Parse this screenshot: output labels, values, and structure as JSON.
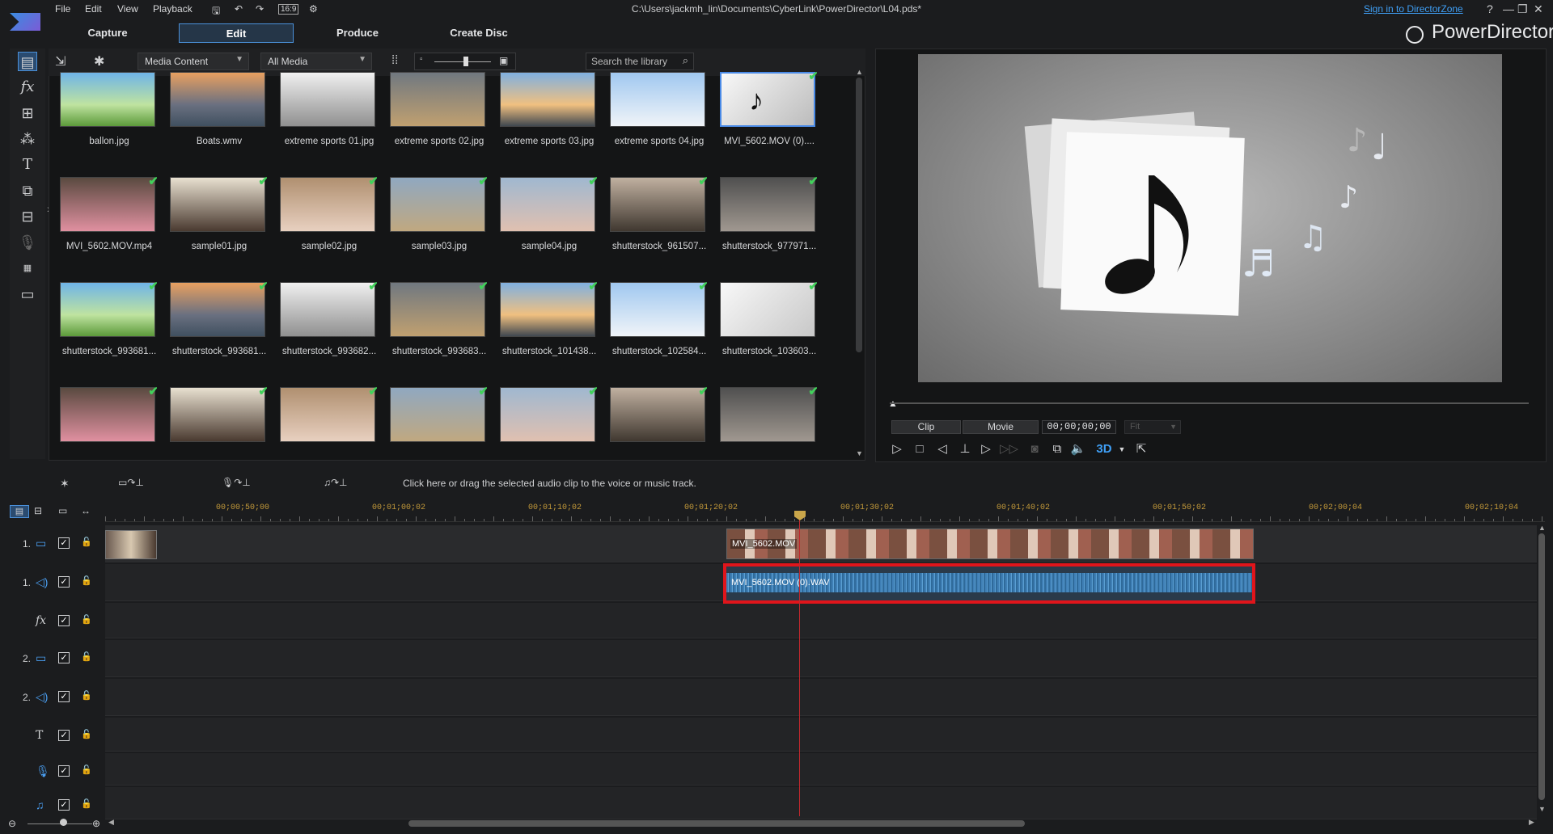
{
  "menu": [
    "File",
    "Edit",
    "View",
    "Playback"
  ],
  "aspect_ratio": "16:9",
  "window_title": "C:\\Users\\jackmh_lin\\Documents\\CyberLink\\PowerDirector\\L04.pds*",
  "signin_label": "Sign in to DirectorZone",
  "window_controls": [
    "?",
    "—",
    "❐",
    "✕"
  ],
  "mode_tabs": [
    "Capture",
    "Edit",
    "Produce",
    "Create Disc"
  ],
  "active_tab": "Edit",
  "brand": "PowerDirector",
  "library": {
    "content_dropdown": "Media Content",
    "filter_dropdown": "All Media",
    "search_placeholder": "Search the library",
    "items": [
      {
        "name": "ballon.jpg",
        "checked": false
      },
      {
        "name": "Boats.wmv",
        "checked": false
      },
      {
        "name": "extreme sports 01.jpg",
        "checked": false
      },
      {
        "name": "extreme sports 02.jpg",
        "checked": false
      },
      {
        "name": "extreme sports 03.jpg",
        "checked": false
      },
      {
        "name": "extreme sports 04.jpg",
        "checked": false
      },
      {
        "name": "MVI_5602.MOV (0)....",
        "checked": true
      },
      {
        "name": "MVI_5602.MOV.mp4",
        "checked": true
      },
      {
        "name": "sample01.jpg",
        "checked": true
      },
      {
        "name": "sample02.jpg",
        "checked": true
      },
      {
        "name": "sample03.jpg",
        "checked": true
      },
      {
        "name": "sample04.jpg",
        "checked": true
      },
      {
        "name": "shutterstock_961507...",
        "checked": true
      },
      {
        "name": "shutterstock_977971...",
        "checked": true
      },
      {
        "name": "shutterstock_993681...",
        "checked": true
      },
      {
        "name": "shutterstock_993681...",
        "checked": true
      },
      {
        "name": "shutterstock_993682...",
        "checked": true
      },
      {
        "name": "shutterstock_993683...",
        "checked": true
      },
      {
        "name": "shutterstock_101438...",
        "checked": true
      },
      {
        "name": "shutterstock_102584...",
        "checked": true
      },
      {
        "name": "shutterstock_103603...",
        "checked": true
      },
      {
        "name": "",
        "checked": true
      },
      {
        "name": "",
        "checked": true
      },
      {
        "name": "",
        "checked": true
      },
      {
        "name": "",
        "checked": true
      },
      {
        "name": "",
        "checked": true
      },
      {
        "name": "",
        "checked": true
      },
      {
        "name": "",
        "checked": true
      }
    ]
  },
  "preview": {
    "clip_label": "Clip",
    "movie_label": "Movie",
    "timecode": "00;00;00;00",
    "fit_label": "Fit",
    "mode_3d": "3D"
  },
  "timeline": {
    "hint": "Click here or drag the selected audio clip to the voice or music track.",
    "ruler_ticks": [
      "00;00;50;00",
      "00;01;00;02",
      "00;01;10;02",
      "00;01;20;02",
      "00;01;30;02",
      "00;01;40;02",
      "00;01;50;02",
      "00;02;00;04",
      "00;02;10;04"
    ],
    "tracks": [
      {
        "num": "1.",
        "icon": "▭",
        "type": "video"
      },
      {
        "num": "1.",
        "icon": "◁)",
        "type": "audio"
      },
      {
        "num": "",
        "icon": "fx",
        "type": "fx"
      },
      {
        "num": "2.",
        "icon": "▭",
        "type": "video"
      },
      {
        "num": "2.",
        "icon": "◁)",
        "type": "audio"
      },
      {
        "num": "",
        "icon": "T",
        "type": "title"
      },
      {
        "num": "",
        "icon": "🎙",
        "type": "voice"
      },
      {
        "num": "",
        "icon": "♫",
        "type": "music"
      }
    ],
    "video_clip_label": "MVI_5602.MOV",
    "audio_clip_label": "MVI_5602.MOV (0).WAV"
  },
  "colors": {
    "accent": "#4a90d9",
    "check": "#41d15a",
    "playhead": "#c0282d",
    "selection": "#e0151b",
    "tick": "#c49a3a"
  }
}
